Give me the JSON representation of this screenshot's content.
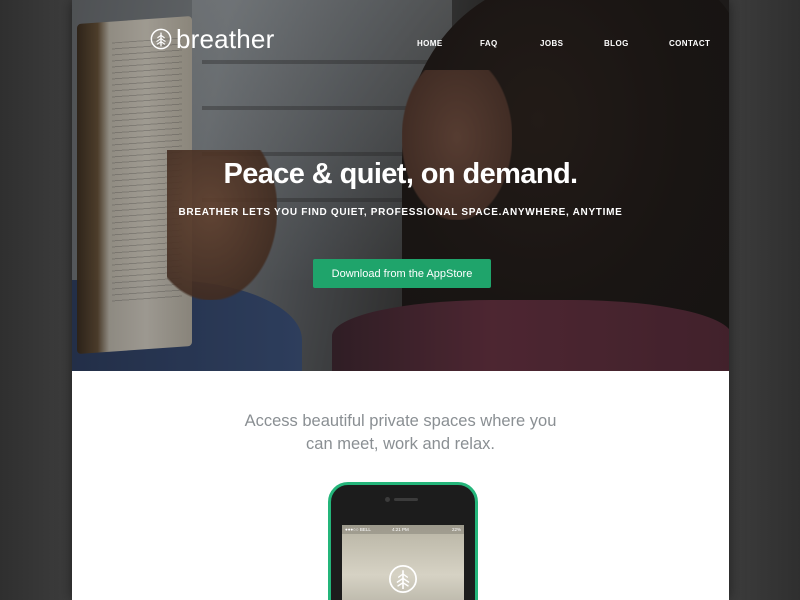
{
  "brand": {
    "name": "breather",
    "icon": "tree-circle-icon",
    "accent_color": "#1fa46b"
  },
  "nav": {
    "items": [
      {
        "label": "HOME"
      },
      {
        "label": "FAQ"
      },
      {
        "label": "JOBS"
      },
      {
        "label": "BLOG"
      },
      {
        "label": "CONTACT"
      }
    ]
  },
  "hero": {
    "headline": "Peace & quiet, on demand.",
    "subhead": "BREATHER LETS YOU FIND QUIET, PROFESSIONAL SPACE.ANYWHERE, ANYTIME",
    "cta_label": "Download from the AppStore"
  },
  "intro": {
    "line1": "Access beautiful private spaces where you",
    "line2": "can meet, work and relax."
  },
  "phone": {
    "carrier": "●●●○○ BELL",
    "time": "4:21 PM",
    "battery": "22%"
  }
}
